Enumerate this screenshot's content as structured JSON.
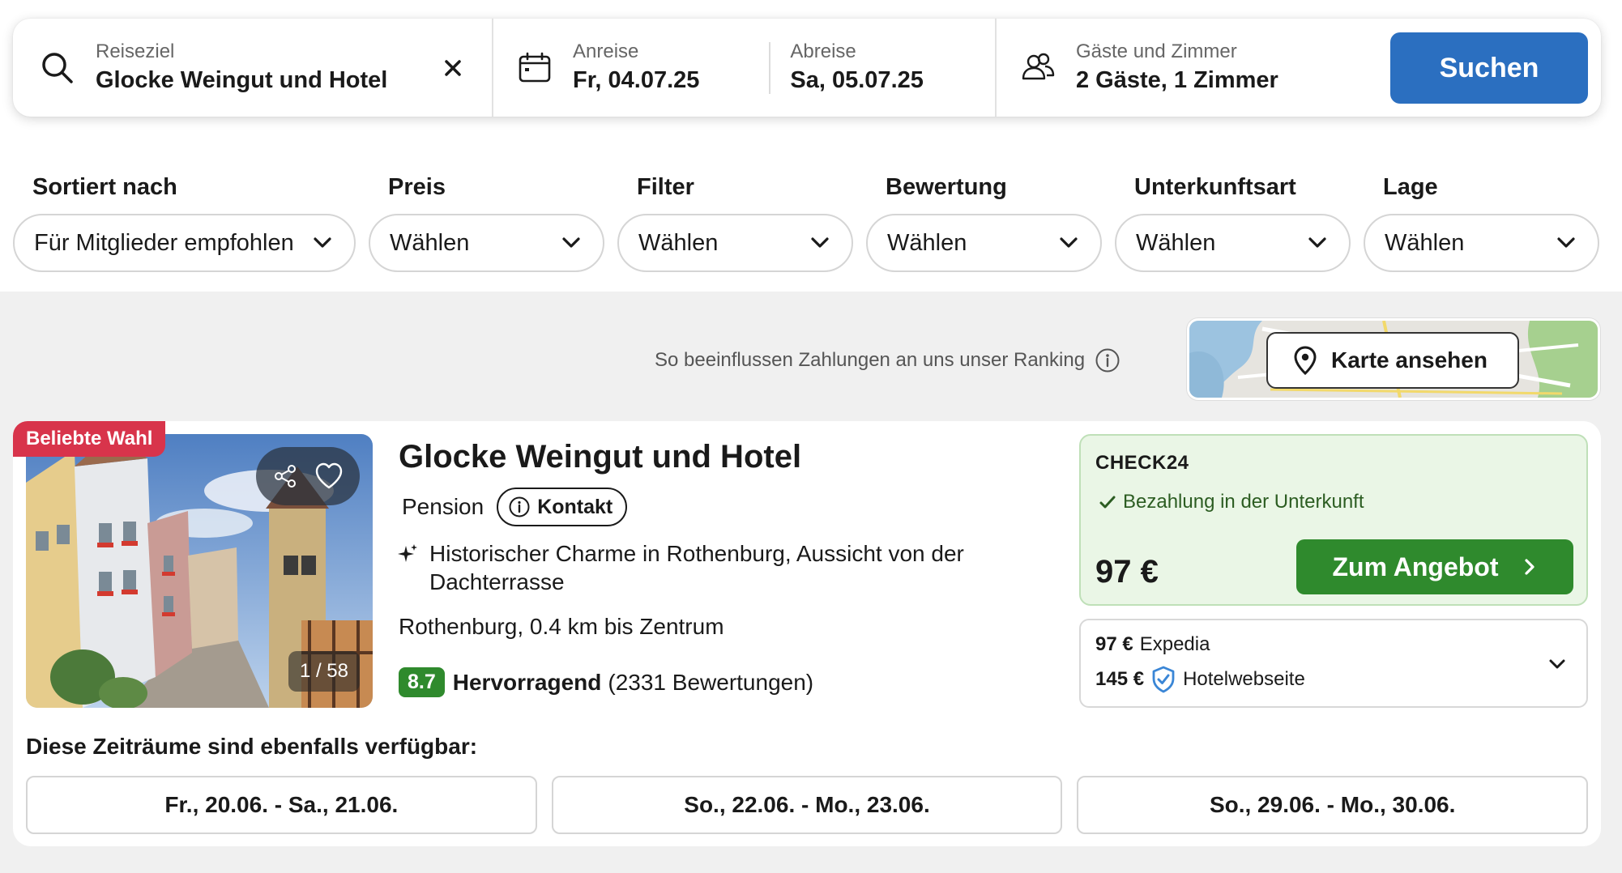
{
  "search": {
    "destination_label": "Reiseziel",
    "destination_value": "Glocke Weingut und Hotel",
    "checkin_label": "Anreise",
    "checkin_value": "Fr, 04.07.25",
    "checkout_label": "Abreise",
    "checkout_value": "Sa, 05.07.25",
    "guests_label": "Gäste und Zimmer",
    "guests_value": "2 Gäste, 1 Zimmer",
    "search_button": "Suchen"
  },
  "filters": [
    {
      "label": "Sortiert nach",
      "value": "Für Mitglieder empfohlen"
    },
    {
      "label": "Preis",
      "value": "Wählen"
    },
    {
      "label": "Filter",
      "value": "Wählen"
    },
    {
      "label": "Bewertung",
      "value": "Wählen"
    },
    {
      "label": "Unterkunftsart",
      "value": "Wählen"
    },
    {
      "label": "Lage",
      "value": "Wählen"
    }
  ],
  "ranking_note": "So beeinflussen Zahlungen an uns unser Ranking",
  "map_button": "Karte ansehen",
  "hotel": {
    "badge": "Beliebte Wahl",
    "name": "Glocke Weingut und Hotel",
    "type": "Pension",
    "contact_label": "Kontakt",
    "highlight": "Historischer Charme in Rothenburg, Aussicht von der Dachterrasse",
    "location": "Rothenburg, 0.4 km bis Zentrum",
    "score": "8.7",
    "rating_word": "Hervorragend",
    "review_count": "(2331 Bewertungen)",
    "image_counter": "1 / 58",
    "offer": {
      "provider": "CHECK24",
      "payment_note": "Bezahlung in der Unterkunft",
      "price": "97 €",
      "button": "Zum Angebot"
    },
    "other_offers": [
      {
        "price": "97 €",
        "provider": "Expedia",
        "verified": false
      },
      {
        "price": "145 €",
        "provider": "Hotelwebseite",
        "verified": true
      }
    ],
    "availability_title": "Diese Zeiträume sind ebenfalls verfügbar:",
    "availability": [
      "Fr., 20.06. - Sa., 21.06.",
      "So., 22.06. - Mo., 23.06.",
      "So., 29.06. - Mo., 30.06."
    ]
  },
  "colors": {
    "primary_blue": "#2b6fc0",
    "offer_green": "#2f8a2d",
    "badge_red": "#d8344b",
    "offer_bg": "#eaf6e6"
  },
  "icons": [
    "search-icon",
    "close-icon",
    "calendar-icon",
    "guests-icon",
    "chevron-down-icon",
    "info-icon",
    "map-pin-icon",
    "share-icon",
    "heart-icon",
    "sparkle-icon",
    "check-icon",
    "chevron-right-icon",
    "shield-check-icon"
  ]
}
